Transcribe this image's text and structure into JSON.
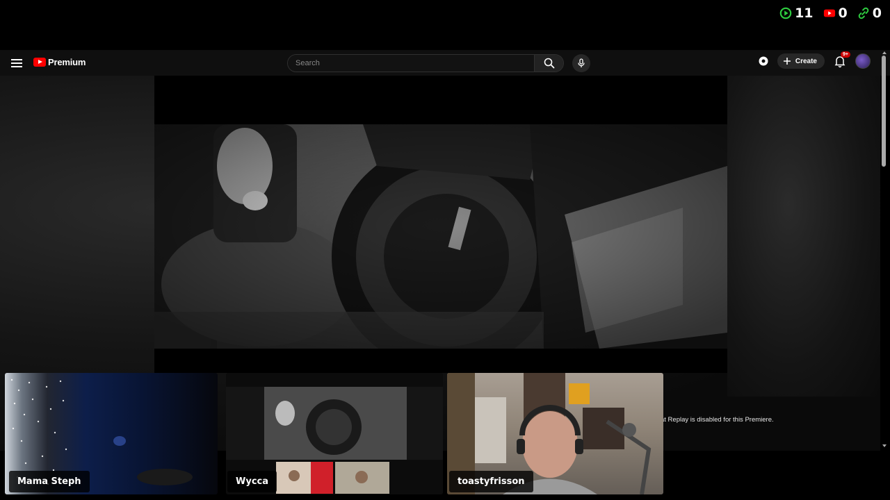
{
  "overlay": {
    "stats": [
      {
        "icon": "play-icon",
        "value": "11",
        "color": "#2ecc40"
      },
      {
        "icon": "youtube-icon",
        "value": "0",
        "color": "#ff0000"
      },
      {
        "icon": "link-icon",
        "value": "0",
        "color": "#2ecc40"
      }
    ]
  },
  "header": {
    "logo_text": "Premium",
    "search_placeholder": "Search",
    "create_label": "Create",
    "notification_badge": "9+"
  },
  "player": {
    "chat_notice": "at Replay is disabled for this Premiere."
  },
  "webcams": [
    {
      "name": "Mama Steph"
    },
    {
      "name": "Wycca"
    },
    {
      "name": "toastyfrisson"
    }
  ],
  "colors": {
    "brand_red": "#ff0000",
    "header_bg": "#0f0f0f",
    "overlay_green": "#2ecc40"
  }
}
